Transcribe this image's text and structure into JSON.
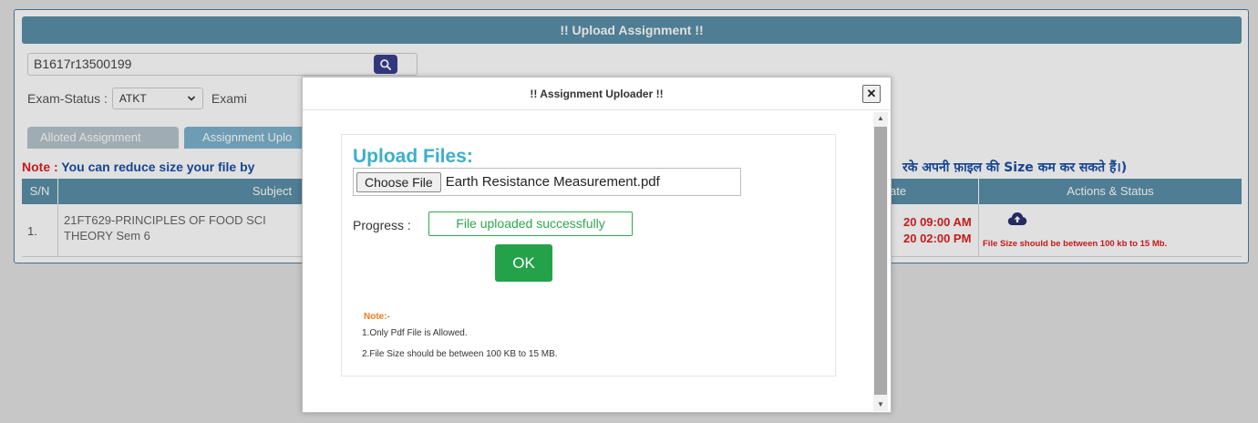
{
  "header": {
    "title": "!! Upload Assignment !!"
  },
  "registration": {
    "value": "B1617r13500199"
  },
  "exam_status": {
    "label": "Exam-Status :",
    "selected": "ATKT",
    "next_label": "Exami"
  },
  "tabs": [
    {
      "label": "Alloted Assignment"
    },
    {
      "label": "Assignment Uplo"
    }
  ],
  "note": {
    "prefix": "Note :",
    "text": " You can reduce size your file by",
    "hindi_text": "रके अपनी फ़ाइल की Size कम कर सकते हैं।)"
  },
  "table": {
    "columns": [
      "S/N",
      "Subject",
      "ate",
      "Actions & Status"
    ],
    "rows": [
      {
        "sn": "1.",
        "subject_line1": "21FT629-PRINCIPLES OF FOOD SCI",
        "subject_line2": "THEORY Sem 6",
        "date_start": "20 09:00 AM",
        "date_end": "20 02:00 PM",
        "status": "File Size should be between 100 kb to 15 Mb."
      }
    ]
  },
  "modal": {
    "title": "!! Assignment Uploader !!",
    "close_label": "✕",
    "upload_title": "Upload Files:",
    "choose_file_label": "Choose File",
    "file_name": "Earth Resistance Measurement.pdf",
    "progress_label": "Progress :",
    "progress_status": "File uploaded successfully",
    "ok_label": "OK",
    "note_heading": "Note:-",
    "note_lines": [
      "1.Only Pdf File is Allowed.",
      "2.File Size should be between 100 KB to 15 MB."
    ]
  },
  "colors": {
    "header_bg": "#5b8fa8",
    "accent_title": "#3bb0c9",
    "success": "#2ea84f",
    "ok_button": "#23a24a",
    "note_red": "#e02020",
    "note_orange": "#f27a1a"
  },
  "icons": {
    "search": "search-icon",
    "upload": "cloud-upload-icon",
    "close": "close-icon",
    "dropdown": "chevron-down-icon"
  }
}
